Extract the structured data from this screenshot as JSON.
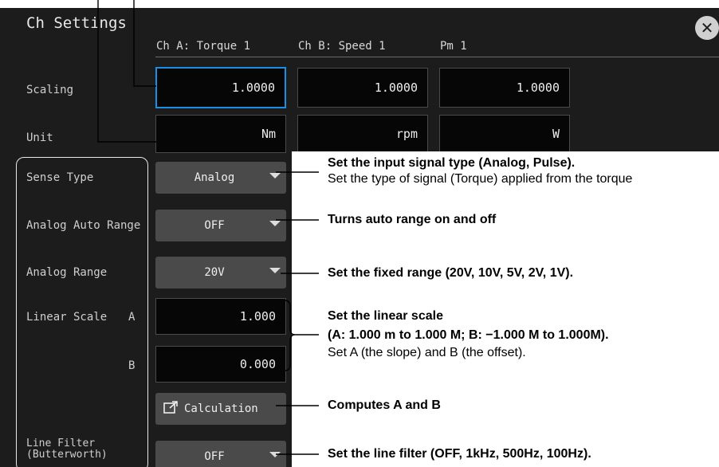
{
  "dialog": {
    "title": "Ch Settings",
    "columns": [
      "Ch A: Torque 1",
      "Ch B: Speed 1",
      "Pm 1"
    ]
  },
  "scaling": {
    "label": "Scaling",
    "values": [
      "1.0000",
      "1.0000",
      "1.0000"
    ]
  },
  "unit": {
    "label": "Unit",
    "values": [
      "Nm",
      "rpm",
      "W"
    ]
  },
  "sense_type": {
    "label": "Sense Type",
    "value": "Analog"
  },
  "auto_range": {
    "label": "Analog Auto Range",
    "value": "OFF"
  },
  "analog_range": {
    "label": "Analog Range",
    "value": "20V"
  },
  "linear_scale": {
    "label": "Linear Scale",
    "a_label": "A",
    "b_label": "B",
    "a_value": "1.000",
    "b_value": "0.000"
  },
  "calculation": {
    "label": "Calculation"
  },
  "line_filter": {
    "label_line1": "Line Filter",
    "label_line2": "(Butterworth)",
    "value": "OFF"
  },
  "annotations": {
    "sense_type_bold": "Set the input signal type (Analog, Pulse).",
    "sense_type_normal": "Set the type of signal (Torque) applied from the torque",
    "auto_range": "Turns auto range on and off",
    "analog_range": "Set the fixed range (20V, 10V, 5V, 2V, 1V).",
    "linear_bold_1": "Set the linear scale",
    "linear_bold_2": "(A: 1.000 m to 1.000 M; B: −1.000 M to 1.000M).",
    "linear_normal": "Set A (the slope) and B (the offset).",
    "calculation": "Computes A and B",
    "line_filter": "Set the line filter (OFF, 1kHz, 500Hz, 100Hz)."
  },
  "icons": {
    "close": "close-icon",
    "dropdown": "dropdown-arrow-icon",
    "calculation": "external-window-icon"
  },
  "colors": {
    "panel_bg": "#1c1c1c",
    "field_bg": "#060606",
    "active_border": "#1a8fe3",
    "button_bg": "#4a4a4a"
  }
}
